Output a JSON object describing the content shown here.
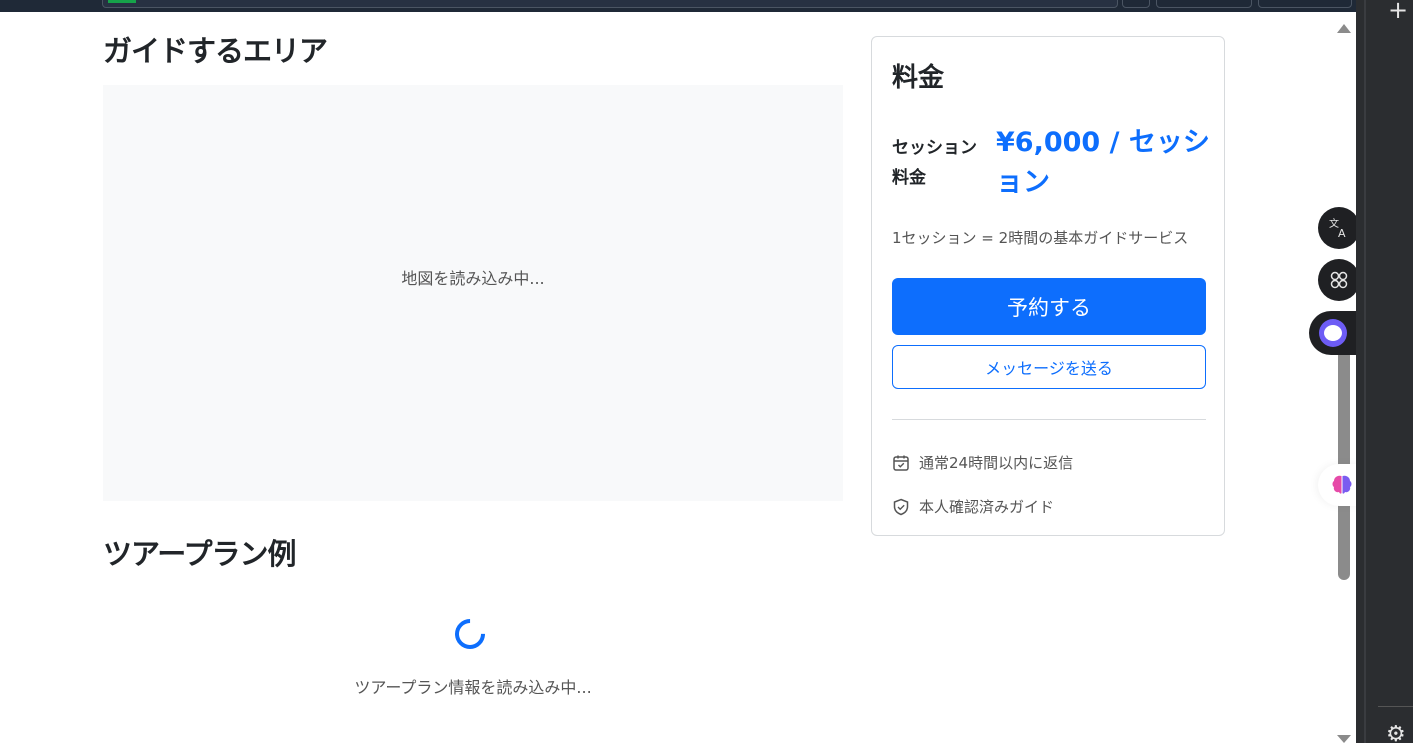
{
  "sections": {
    "area_title": "ガイドするエリア",
    "map_loading": "地図を読み込み中...",
    "plan_title": "ツアープラン例",
    "plan_loading": "ツアープラン情報を読み込み中..."
  },
  "pricing": {
    "title": "料金",
    "session_label": "セッション料金",
    "session_price": "¥6,000 / セッション",
    "note": "1セッション = 2時間の基本ガイドサービス",
    "book_button": "予約する",
    "message_button": "メッセージを送る",
    "info": [
      {
        "icon": "calendar-icon",
        "text": "通常24時間以内に返信"
      },
      {
        "icon": "shield-icon",
        "text": "本人確認済みガイド"
      }
    ]
  },
  "colors": {
    "accent": "#0d6efd",
    "map_bg": "#f8f9fa",
    "text": "#212529",
    "muted": "#555555"
  },
  "floating_icons": [
    "translate-icon",
    "apps-icon",
    "ai-assistant-icon",
    "brain-icon"
  ],
  "browser_icons": [
    "plus-icon",
    "settings-gear-icon"
  ]
}
